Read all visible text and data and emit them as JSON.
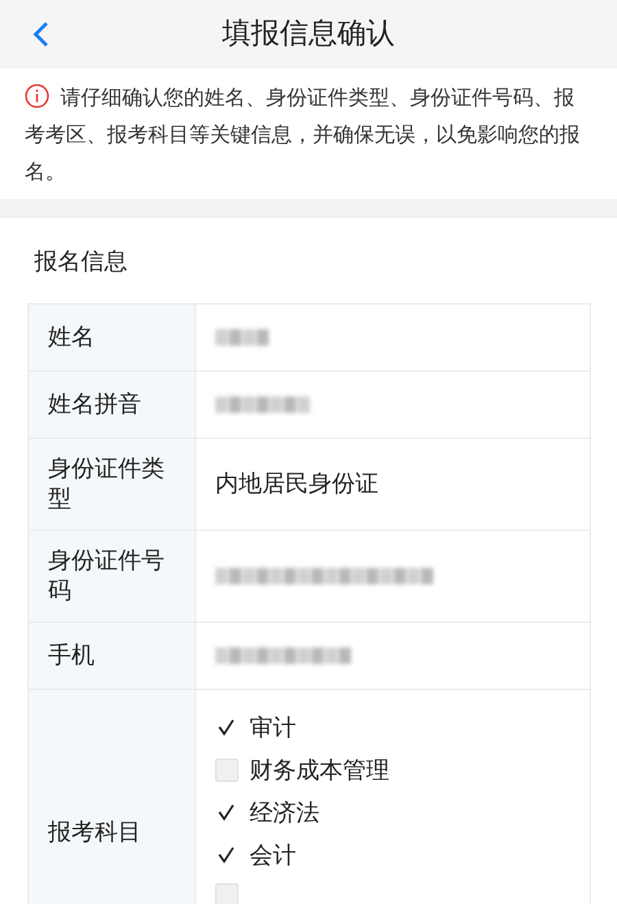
{
  "header": {
    "title": "填报信息确认"
  },
  "notice": {
    "text": "请仔细确认您的姓名、身份证件类型、身份证件号码、报考考区、报考科目等关键信息，并确保无误，以免影响您的报名。"
  },
  "section": {
    "title": "报名信息"
  },
  "rows": [
    {
      "label": "姓名",
      "kind": "redacted"
    },
    {
      "label": "姓名拼音",
      "kind": "redacted"
    },
    {
      "label": "身份证件类型",
      "kind": "text",
      "value": "内地居民身份证"
    },
    {
      "label": "身份证件号码",
      "kind": "redacted"
    },
    {
      "label": "手机",
      "kind": "redacted"
    },
    {
      "label": "报考科目",
      "kind": "subjects",
      "subjects": [
        {
          "name": "审计",
          "checked": true
        },
        {
          "name": "财务成本管理",
          "checked": false
        },
        {
          "name": "经济法",
          "checked": true
        },
        {
          "name": "会计",
          "checked": true
        },
        {
          "checked": false
        }
      ]
    }
  ]
}
